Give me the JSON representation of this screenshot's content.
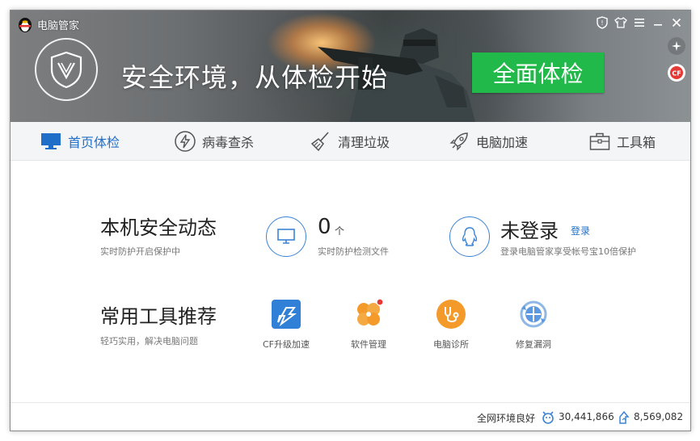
{
  "app": {
    "title": "电脑管家"
  },
  "titlebar": {
    "buttons": [
      "shield-icon",
      "shirt-icon",
      "menu-icon",
      "minimize-icon",
      "close-icon"
    ]
  },
  "banner": {
    "slogan": "安全环境，从体检开始",
    "scan_button": "全面体检",
    "side_icons": [
      "sparkle-icon",
      "cf-game-icon"
    ]
  },
  "nav": {
    "items": [
      {
        "label": "首页体检",
        "icon": "monitor-icon",
        "active": true
      },
      {
        "label": "病毒查杀",
        "icon": "lightning-icon",
        "active": false
      },
      {
        "label": "清理垃圾",
        "icon": "broom-icon",
        "active": false
      },
      {
        "label": "电脑加速",
        "icon": "rocket-icon",
        "active": false
      },
      {
        "label": "工具箱",
        "icon": "toolbox-icon",
        "active": false
      }
    ]
  },
  "security": {
    "title": "本机安全动态",
    "subtitle": "实时防护开启保护中",
    "count": "0",
    "count_unit": "个",
    "count_caption": "实时防护检测文件",
    "login_title": "未登录",
    "login_link": "登录",
    "login_caption": "登录电脑管家享受帐号宝10倍保护"
  },
  "tools": {
    "title": "常用工具推荐",
    "subtitle": "轻巧实用，解决电脑问题",
    "items": [
      {
        "label": "CF升级加速",
        "icon": "cf-boost-icon",
        "color": "#2f80d6"
      },
      {
        "label": "软件管理",
        "icon": "software-manager-icon",
        "color": "#f39a2a"
      },
      {
        "label": "电脑诊所",
        "icon": "stethoscope-icon",
        "color": "#f39a2a"
      },
      {
        "label": "修复漏洞",
        "icon": "patch-icon",
        "color": "#3b83d6"
      }
    ]
  },
  "status": {
    "network": "全网环境良好",
    "protected_count": "30,441,866",
    "rank_count": "8,569,082"
  },
  "colors": {
    "accent": "#1f6fc8",
    "scan_button": "#21b94a"
  }
}
